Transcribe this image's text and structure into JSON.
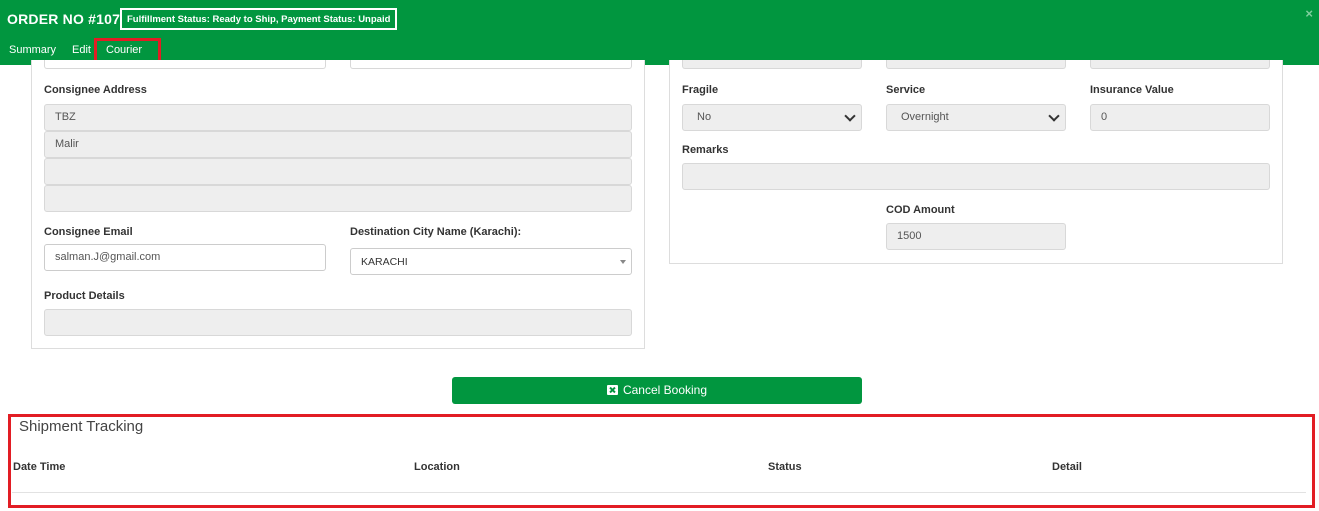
{
  "header": {
    "order_title": "ORDER NO #107",
    "status_text": "Fulfillment Status: Ready to Ship,  Payment Status: Unpaid",
    "close": "×",
    "brand_color": "#01963f"
  },
  "tabs": [
    {
      "label": "Summary"
    },
    {
      "label": "Edit"
    },
    {
      "label": "Courier",
      "active": true
    }
  ],
  "left_form": {
    "consignee_address_label": "Consignee Address",
    "address_lines": [
      "TBZ",
      "Malir",
      "",
      ""
    ],
    "consignee_email_label": "Consignee Email",
    "consignee_email_value": "salman.J@gmail.com",
    "destination_city_label": "Destination City Name (Karachi):",
    "destination_city_value": "KARACHI",
    "product_details_label": "Product Details",
    "product_details_value": ""
  },
  "right_form": {
    "fragile_label": "Fragile",
    "fragile_value": "No",
    "service_label": "Service",
    "service_value": "Overnight",
    "insurance_label": "Insurance Value",
    "insurance_value": "0",
    "remarks_label": "Remarks",
    "remarks_value": "",
    "cod_label": "COD Amount",
    "cod_value": "1500"
  },
  "actions": {
    "cancel_booking": "Cancel Booking"
  },
  "tracking": {
    "title": "Shipment Tracking",
    "columns": [
      "Date Time",
      "Location",
      "Status",
      "Detail"
    ]
  },
  "highlight_color": "#e21d24"
}
